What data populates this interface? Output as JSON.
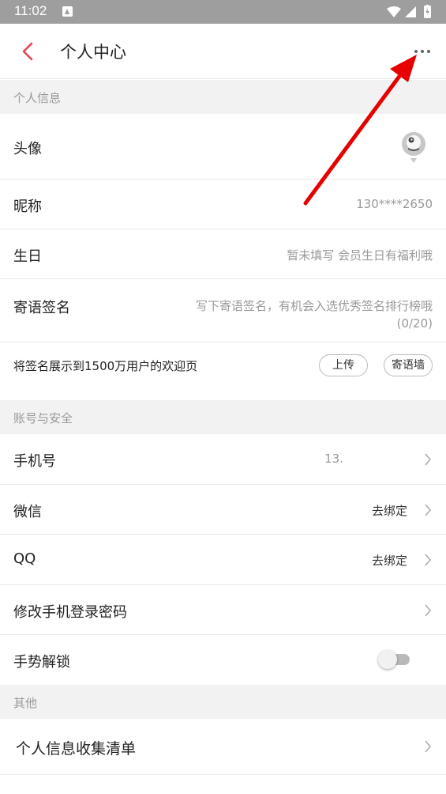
{
  "status_bar": {
    "time": "11:02"
  },
  "header": {
    "title": "个人中心"
  },
  "sections": {
    "personal": "个人信息",
    "account": "账号与安全",
    "other": "其他"
  },
  "personal": {
    "avatar_label": "头像",
    "nickname_label": "昵称",
    "nickname_value": "130****2650",
    "birthday_label": "生日",
    "birthday_value": "暂未填写 会员生日有福利哦",
    "signature_label": "寄语签名",
    "signature_placeholder_line1": "写下寄语签名，有机会入选优秀签名排行榜哦",
    "signature_placeholder_line2": "(0/20)",
    "showcase_text": "将签名展示到1500万用户的欢迎页",
    "upload_button": "上传",
    "wall_button": "寄语墙"
  },
  "account": {
    "phone_label": "手机号",
    "phone_value": "13.",
    "wechat_label": "微信",
    "wechat_value": "去绑定",
    "qq_label": "QQ",
    "qq_value": "去绑定",
    "password_label": "修改手机登录密码",
    "gesture_label": "手势解锁",
    "gesture_enabled": false
  },
  "other": {
    "collection_label": "个人信息收集清单"
  },
  "colors": {
    "accent": "#e8424f",
    "annotation_arrow": "#e60000",
    "section_bg": "#f2f2f2"
  },
  "icons": {
    "back": "chevron-left-icon",
    "more": "more-dots-icon",
    "row_arrow": "chevron-right-icon",
    "avatar": "default-avatar-icon"
  }
}
